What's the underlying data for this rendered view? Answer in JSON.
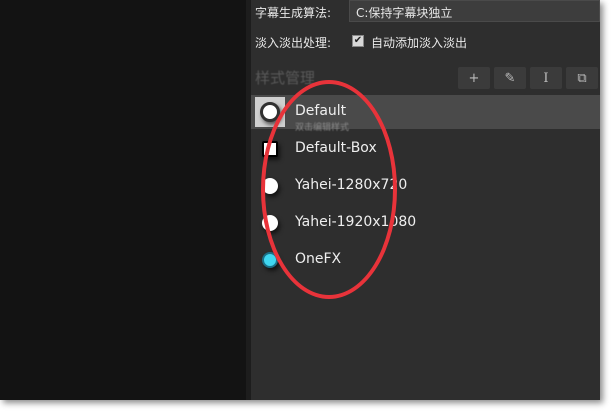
{
  "settings": {
    "algorithm_label": "字幕生成算法:",
    "algorithm_value": "C:保持字幕块独立",
    "fade_label": "淡入淡出处理:",
    "fade_checkbox_mark": "✔",
    "fade_checkbox_label": "自动添加淡入淡出"
  },
  "style_panel": {
    "title": "样式管理",
    "toolbar": {
      "add_glyph": "+",
      "edit_glyph": "✎",
      "rename_glyph": "I",
      "copy_glyph": "⧉"
    },
    "items": [
      {
        "label": "Default",
        "sublabel": "双击编辑样式"
      },
      {
        "label": "Default-Box"
      },
      {
        "label": "Yahei-1280x720"
      },
      {
        "label": "Yahei-1920x1080"
      },
      {
        "label": "OneFX"
      }
    ]
  },
  "colors": {
    "annotation": "#e8333a",
    "onefx_icon": "#3fd6f0",
    "panel_bg": "#2e2e2e",
    "selected_bg": "#4a4a4a"
  },
  "icons": [
    "plus-icon",
    "pencil-icon",
    "text-cursor-icon",
    "copy-icon",
    "style-preview-icon"
  ]
}
